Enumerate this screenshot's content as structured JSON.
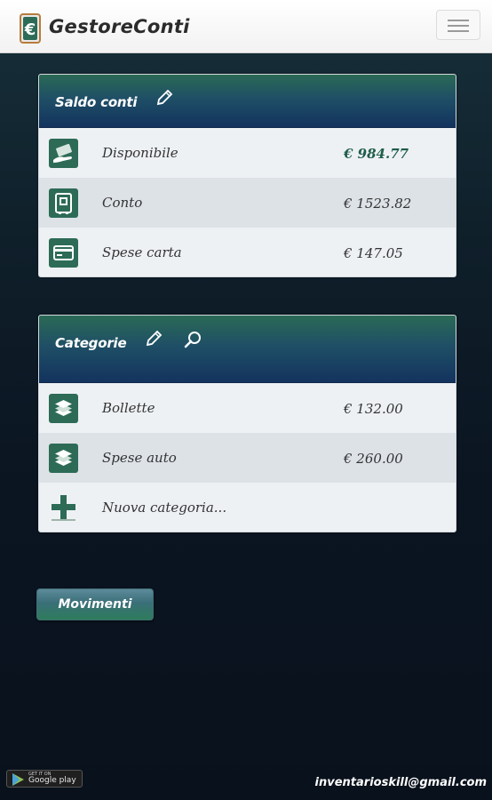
{
  "header": {
    "brand": "GestoreConti",
    "logo_icon": "euro-wallet-icon",
    "menu_icon": "hamburger-menu-icon"
  },
  "saldo": {
    "title": "Saldo conti",
    "edit_icon": "pencil-icon",
    "rows": [
      {
        "icon": "cash-hand-icon",
        "label": "Disponibile",
        "value": "€ 984.77",
        "highlight": true
      },
      {
        "icon": "safe-icon",
        "label": "Conto",
        "value": "€ 1523.82",
        "highlight": false
      },
      {
        "icon": "credit-card-icon",
        "label": "Spese carta",
        "value": "€ 147.05",
        "highlight": false
      }
    ]
  },
  "categorie": {
    "title": "Categorie",
    "edit_icon": "pencil-icon",
    "search_icon": "search-icon",
    "rows": [
      {
        "icon": "stack-layers-icon",
        "label": "Bollette",
        "value": "€ 132.00"
      },
      {
        "icon": "stack-layers-icon",
        "label": "Spese auto",
        "value": "€ 260.00"
      }
    ],
    "new_label": "Nuova categoria..."
  },
  "movimenti_button": "Movimenti",
  "footer": {
    "google_play_small": "GET IT ON",
    "google_play": "Google play",
    "email": "inventarioskill@gmail.com"
  },
  "colors": {
    "accent_green": "#2d6b57",
    "header_blue": "#13335e",
    "background": "#0b1522"
  }
}
